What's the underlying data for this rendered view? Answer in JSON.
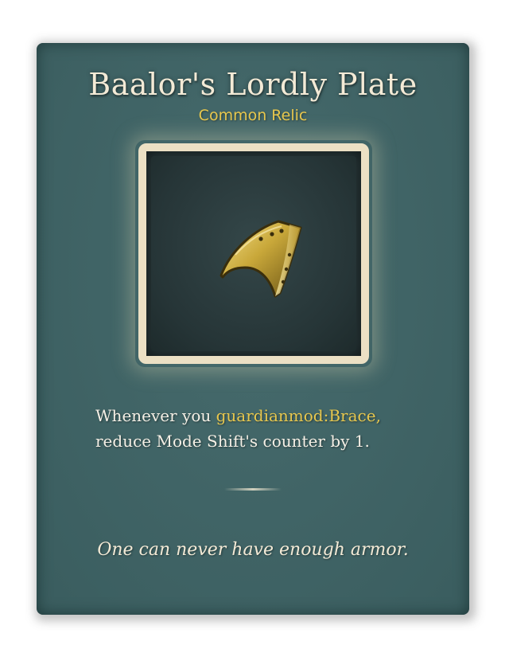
{
  "card": {
    "title": "Baalor's Lordly Plate",
    "rarity": "Common Relic",
    "relic_icon": "golden-armor-plate-icon",
    "description": {
      "line1_prefix": "Whenever you ",
      "line1_keyword": "guardianmod:Brace,",
      "line2": "reduce Mode Shift's counter by 1."
    },
    "flavor": "One can never have enough armor."
  },
  "colors": {
    "card_background": "#3f6567",
    "title": "#f3ead6",
    "rarity": "#e7c74e",
    "keyword": "#e7c74e",
    "frame": "#ece0c4"
  }
}
